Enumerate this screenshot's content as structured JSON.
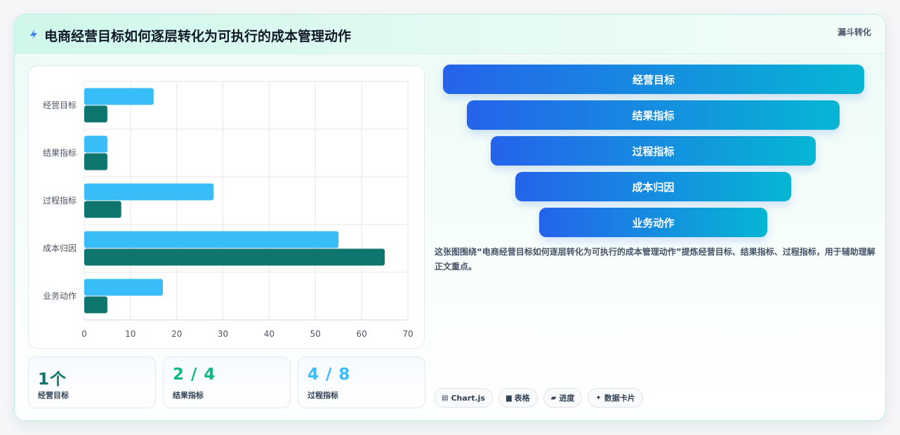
{
  "header": {
    "icon": "lightning-icon",
    "title": "电商经营目标如何逐层转化为可执行的成本管理动作",
    "tag": "漏斗转化"
  },
  "chart_data": {
    "type": "bar",
    "orientation": "horizontal",
    "categories": [
      "经营目标",
      "结果指标",
      "过程指标",
      "成本归因",
      "业务动作"
    ],
    "series": [
      {
        "values": [
          15,
          5,
          28,
          55,
          17
        ],
        "color": "#38bdf8"
      },
      {
        "values": [
          5,
          5,
          8,
          65,
          5
        ],
        "color": "#0f766e"
      }
    ],
    "xlim": [
      0,
      70
    ],
    "xticks": [
      0,
      10,
      20,
      30,
      40,
      50,
      60,
      70
    ],
    "grid": true
  },
  "stats": [
    {
      "value": "1个",
      "label": "经营目标",
      "color": "#0f766e"
    },
    {
      "value": "2 / 4",
      "label": "结果指标",
      "color": "#10b981"
    },
    {
      "value": "4 / 8",
      "label": "过程指标",
      "color": "#38bdf8"
    }
  ],
  "funnel": [
    "经营目标",
    "结果指标",
    "过程指标",
    "成本归因",
    "业务动作"
  ],
  "description": "这张图围绕“电商经营目标如何逐层转化为可执行的成本管理动作”提炼经营目标、结果指标、过程指标，用于辅助理解正文重点。",
  "chips": [
    {
      "icon": "chart-icon",
      "glyph": "▤",
      "label": "Chart.js"
    },
    {
      "icon": "table-icon",
      "glyph": "▆",
      "label": "表格"
    },
    {
      "icon": "progress-icon",
      "glyph": "▰",
      "label": "进度"
    },
    {
      "icon": "sparkle-icon",
      "glyph": "✦",
      "label": "数据卡片"
    }
  ]
}
